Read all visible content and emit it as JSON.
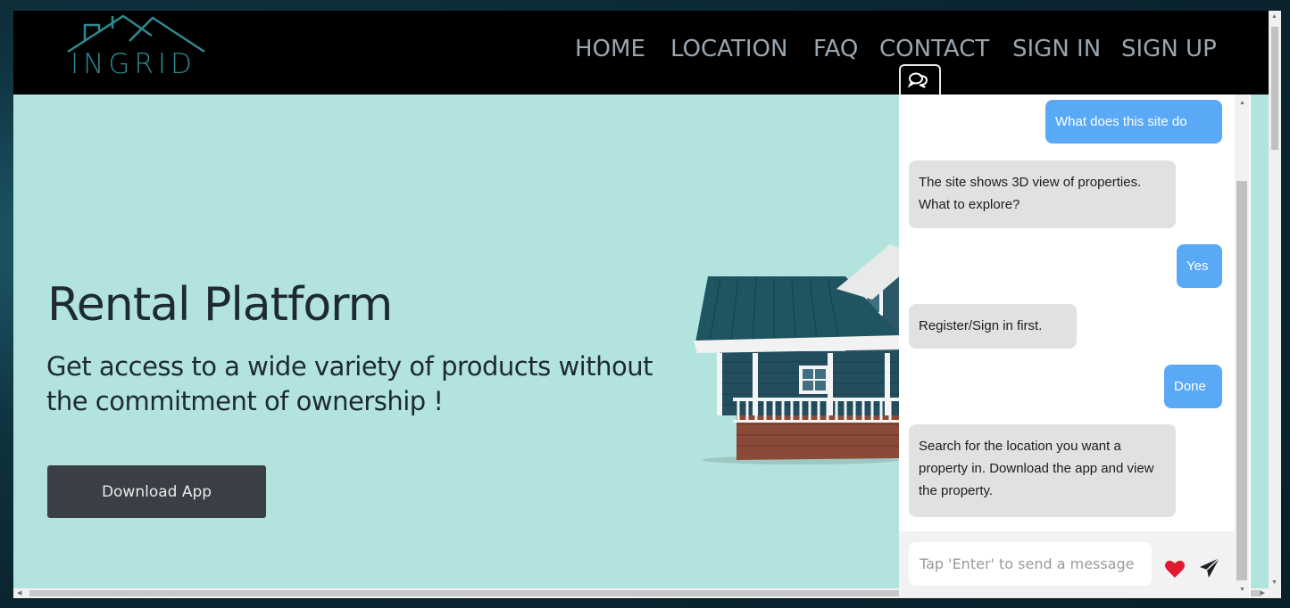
{
  "brand": {
    "logo_text": "INGRID"
  },
  "nav": {
    "items": [
      {
        "label": "HOME"
      },
      {
        "label": "LOCATION"
      },
      {
        "label": "FAQ"
      },
      {
        "label": "CONTACT"
      },
      {
        "label": "SIGN IN"
      },
      {
        "label": "SIGN UP"
      }
    ]
  },
  "hero": {
    "title": "Rental Platform",
    "subtitle": "Get access to a wide variety of products without the commitment of ownership !",
    "cta_label": "Download App"
  },
  "chat": {
    "messages": [
      {
        "from": "user",
        "text": "What does this site do"
      },
      {
        "from": "bot",
        "text": "The site shows 3D view of properties. What to explore?"
      },
      {
        "from": "user",
        "text": "Yes"
      },
      {
        "from": "bot",
        "text": "Register/Sign in first."
      },
      {
        "from": "user",
        "text": "Done"
      },
      {
        "from": "bot",
        "text": "Search for the location you want a property in. Download the app and view the property."
      }
    ],
    "input_placeholder": "Tap 'Enter' to send a message",
    "icons": {
      "tab": "chat-bubbles-icon",
      "like": "heart-icon",
      "send": "send-icon"
    }
  },
  "colors": {
    "page_background": "#b2e3de",
    "navbar": "#000000",
    "user_bubble": "#5aa9f7",
    "bot_bubble": "#e1e1e1",
    "button": "#3a3e45",
    "heart": "#e0192f"
  }
}
